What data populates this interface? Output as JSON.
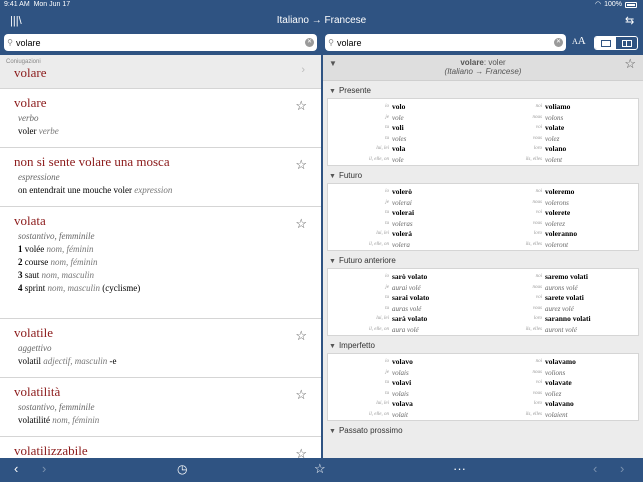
{
  "status": {
    "time": "9:41 AM",
    "date": "Mon Jun 17",
    "battery": "100%"
  },
  "header": {
    "title": "Italiano → Francese"
  },
  "search": {
    "left_value": "volare",
    "right_value": "volare"
  },
  "conjugation_link": {
    "small": "Coniugazioni",
    "word": "volare"
  },
  "entries": [
    {
      "headword": "volare",
      "pos": "verbo",
      "translations": [
        {
          "text": "voler",
          "note": "verbe"
        }
      ]
    },
    {
      "headword": "non si sente volare una mosca",
      "pos": "espressione",
      "translations": [
        {
          "text": "on entendrait une mouche voler",
          "note": "expression"
        }
      ]
    },
    {
      "headword": "volata",
      "pos": "sostantivo, femminile",
      "translations": [
        {
          "num": "1",
          "text": "volée",
          "note": "nom, féminin"
        },
        {
          "num": "2",
          "text": "course",
          "note": "nom, féminin"
        },
        {
          "num": "3",
          "text": "saut",
          "note": "nom, masculin"
        },
        {
          "num": "4",
          "text": "sprint",
          "note": "nom, masculin",
          "extra": "(cyclisme)"
        }
      ]
    },
    {
      "headword": "volatile",
      "pos": "aggettivo",
      "translations": [
        {
          "text": "volatil",
          "note": "adjectif, masculin",
          "extra": "-e"
        }
      ]
    },
    {
      "headword": "volatilità",
      "pos": "sostantivo, femminile",
      "translations": [
        {
          "text": "volatilité",
          "note": "nom, féminin"
        }
      ]
    },
    {
      "headword": "volatilizzabile",
      "pos": "",
      "translations": []
    }
  ],
  "right_header": {
    "word": "volare",
    "sep": ": ",
    "lemma": "voler",
    "subtitle": "(Italiano → Francese)"
  },
  "pronouns": {
    "left": [
      "io",
      "tu",
      "tu",
      "tu",
      "lui, lei",
      "il, elle, on"
    ],
    "right": [
      "noi",
      "nous",
      "voi",
      "vous",
      "loro",
      "ils, elles"
    ]
  },
  "pronouns_fr": {
    "left": [
      "io",
      "je",
      "tu",
      "tu",
      "lui, lei",
      "il, elle, on"
    ],
    "right": [
      "noi",
      "nous",
      "voi",
      "vous",
      "loro",
      "ils, elles"
    ]
  },
  "sections": [
    {
      "title": "Presente",
      "left": [
        "volo",
        "vole",
        "voli",
        "voles",
        "vola",
        "vole"
      ],
      "right": [
        "voliamo",
        "volons",
        "volate",
        "volez",
        "volano",
        "volent"
      ]
    },
    {
      "title": "Futuro",
      "left": [
        "volerò",
        "volerai",
        "volerai",
        "voleras",
        "volerà",
        "volera"
      ],
      "right": [
        "voleremo",
        "volerons",
        "volerete",
        "volerez",
        "voleranno",
        "voleront"
      ]
    },
    {
      "title": "Futuro anteriore",
      "left": [
        "sarò volato",
        "aurai volé",
        "sarai volato",
        "auras volé",
        "sarà volato",
        "aura volé"
      ],
      "right": [
        "saremo volati",
        "aurons volé",
        "sarete volati",
        "aurez volé",
        "saranno volati",
        "auront volé"
      ]
    },
    {
      "title": "Imperfetto",
      "left": [
        "volavo",
        "volais",
        "volavi",
        "volais",
        "volava",
        "volait"
      ],
      "right": [
        "volavamo",
        "volions",
        "volavate",
        "voliez",
        "volavano",
        "volaient"
      ]
    },
    {
      "title": "Passato prossimo",
      "left": [],
      "right": []
    }
  ],
  "icons": {
    "library": "library-icon",
    "swap": "swap-icon",
    "back": "back-icon",
    "forward": "forward-icon",
    "history": "history-icon",
    "favorite": "star-icon",
    "more": "more-icon"
  }
}
